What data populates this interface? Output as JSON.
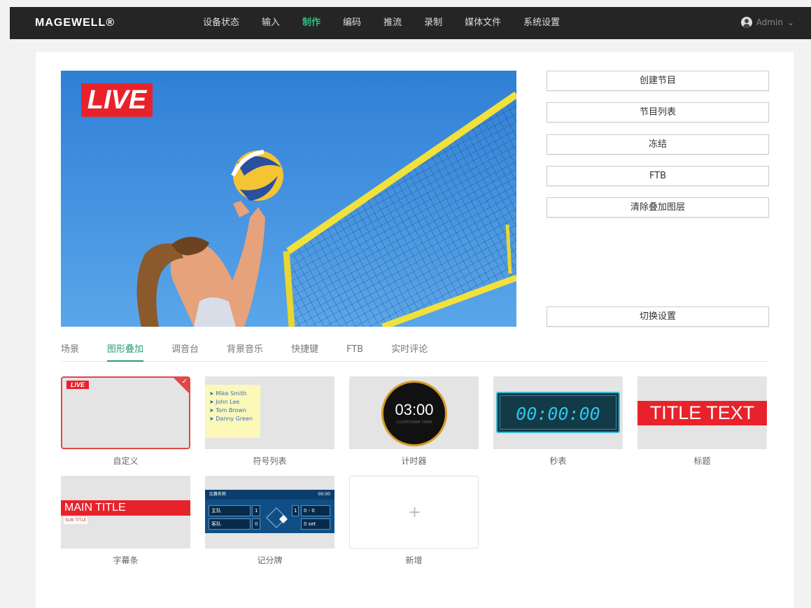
{
  "brand": {
    "logo": "MAGEWELL®"
  },
  "nav": {
    "items": [
      "设备状态",
      "输入",
      "制作",
      "编码",
      "推流",
      "录制",
      "媒体文件",
      "系统设置"
    ],
    "active": "制作"
  },
  "user": {
    "name": "Admin",
    "chevron": "⌄"
  },
  "preview": {
    "live_badge": "LIVE"
  },
  "side_buttons": {
    "create_program": "创建节目",
    "program_list": "节目列表",
    "freeze": "冻结",
    "ftb": "FTB",
    "clear_overlay": "清除叠加图层",
    "switch_settings": "切换设置"
  },
  "tabs": {
    "items": [
      "场景",
      "图形叠加",
      "调音台",
      "背景音乐",
      "快捷键",
      "FTB",
      "实时评论"
    ],
    "active": "图形叠加"
  },
  "cards": {
    "custom": {
      "label": "自定义",
      "thumb_text": "LIVE",
      "check": "✓"
    },
    "bullet_list": {
      "label": "符号列表",
      "bullet": "➤",
      "items": [
        "Mike Smith",
        "John Lee",
        "Tom Brown",
        "Danny Green"
      ]
    },
    "timer": {
      "label": "计时器",
      "value": "03:00",
      "sub": "COUNTDOWN TIMER"
    },
    "stopwatch": {
      "label": "秒表",
      "value": "00:00:00"
    },
    "title": {
      "label": "标题",
      "text": "TITLE TEXT"
    },
    "lower_third": {
      "label": "字幕条",
      "main": "MAIN TITLE",
      "sub": "SUB TITLE"
    },
    "scoreboard": {
      "label": "记分牌",
      "header_left": "比赛名称",
      "header_right": "00:00",
      "team1": "主队",
      "team2": "客队",
      "score1": "1",
      "score2": "0",
      "mid": "1",
      "set1": "0 - 0",
      "set2": "0 set"
    },
    "add_new": {
      "label": "新增",
      "plus": "+"
    }
  },
  "colors": {
    "accent": "#2fbf7f",
    "live_red": "#e8222b",
    "selected_border": "#e04848"
  }
}
